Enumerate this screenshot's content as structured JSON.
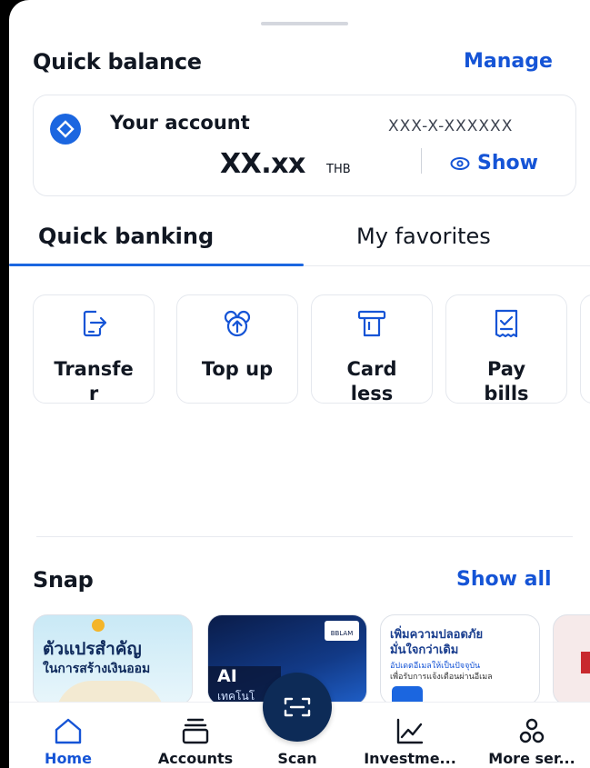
{
  "quick_balance": {
    "title": "Quick balance",
    "manage_label": "Manage",
    "account_label": "Your account",
    "account_number": "XXX-X-XXXXXX",
    "balance": "XX.xx",
    "currency": "THB",
    "show_label": "Show"
  },
  "tabs": [
    {
      "label": "Quick banking",
      "active": true
    },
    {
      "label": "My favorites",
      "active": false
    }
  ],
  "quick_actions": [
    {
      "label": "Transfe\nr",
      "icon": "transfer-icon"
    },
    {
      "label": "Top up",
      "icon": "top-up-icon"
    },
    {
      "label": "Card\nless",
      "icon": "cardless-icon"
    },
    {
      "label": "Pay\nbills",
      "icon": "pay-bills-icon"
    }
  ],
  "snap": {
    "title": "Snap",
    "show_all_label": "Show all",
    "cards": [
      {
        "line1": "ตัวแปรสำคัญ",
        "line2": "ในการสร้างเงินออม"
      },
      {
        "brand": "BBLAM",
        "line1": "AI",
        "line2": "เทคโนโ"
      },
      {
        "line1": "เพิ่มความปลอดภัย",
        "line2": "มั่นใจกว่าเดิม",
        "line3": "อัปเดตอีเมลให้เป็นปัจจุบัน",
        "line4": "เพื่อรับการแจ้งเตือนผ่านอีเมล"
      }
    ]
  },
  "bottom_nav": [
    {
      "label": "Home",
      "icon": "home-icon",
      "active": true
    },
    {
      "label": "Accounts",
      "icon": "accounts-icon",
      "active": false
    },
    {
      "label": "Scan",
      "icon": "scan-icon",
      "active": false
    },
    {
      "label": "Investme...",
      "icon": "investment-icon",
      "active": false
    },
    {
      "label": "More ser...",
      "icon": "more-services-icon",
      "active": false
    }
  ],
  "colors": {
    "accent": "#1554d6",
    "text": "#111722",
    "scan_button": "#0d2b57"
  }
}
